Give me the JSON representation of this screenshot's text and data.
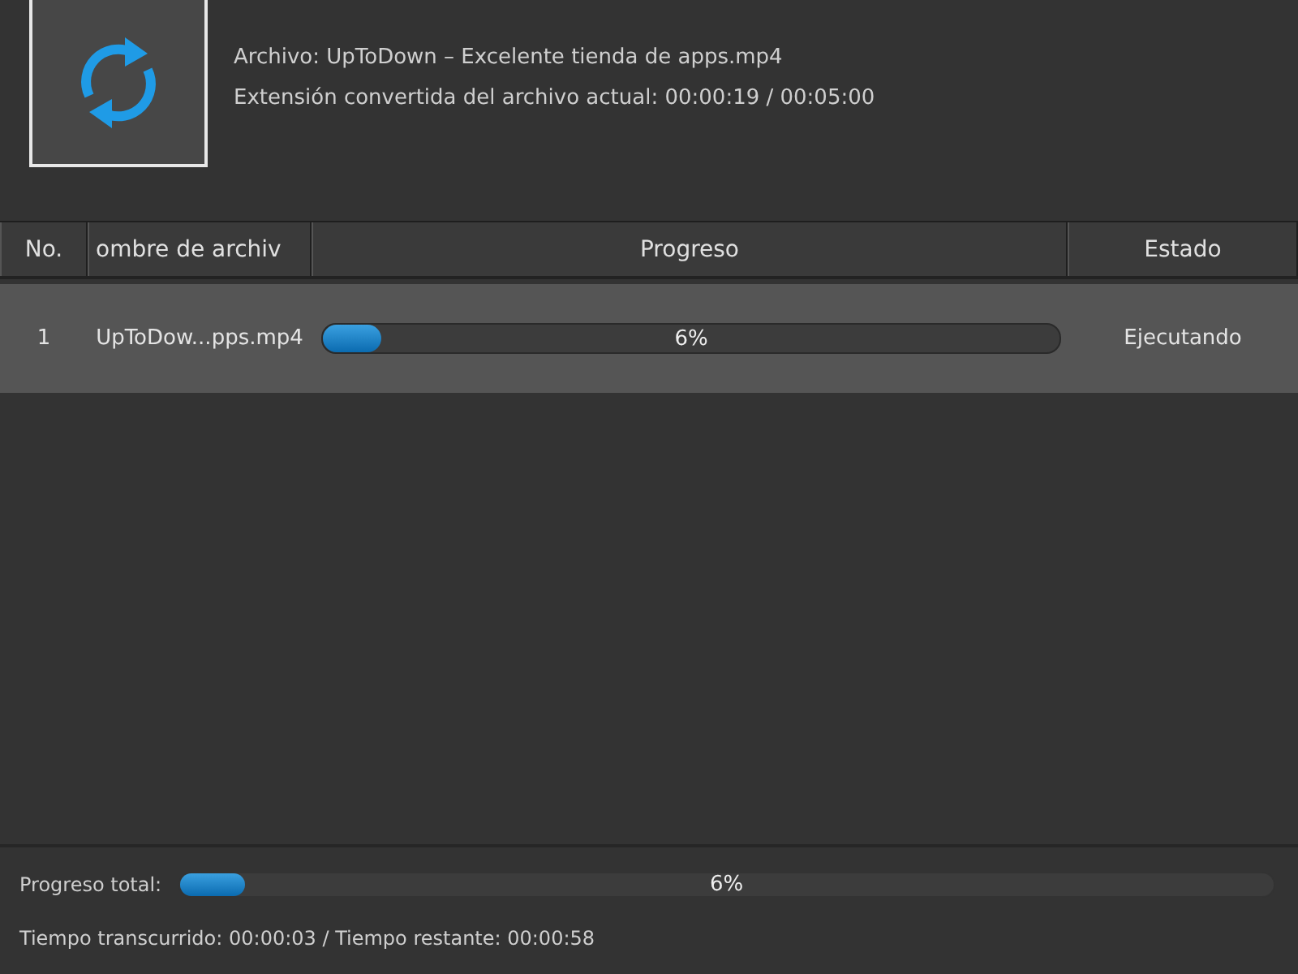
{
  "info": {
    "file": "Archivo: UpToDown – Excelente tienda de apps.mp4",
    "extension": "Extensión convertida del archivo actual: 00:00:19 / 00:05:00"
  },
  "table": {
    "columns": [
      "No.",
      "ombre de archiv",
      "Progreso",
      "Estado"
    ],
    "rows": [
      {
        "no": "1",
        "name": "UpToDow...pps.mp4",
        "level": 0.08,
        "progress": "6%",
        "status": "Ejecutando",
        "selected": true
      }
    ]
  },
  "total": {
    "label": "Progreso total:",
    "level": 0.06,
    "reading": "6%"
  },
  "times": "Tiempo transcurrido: 00:00:03 / Tiempo restante: 00:00:58"
}
